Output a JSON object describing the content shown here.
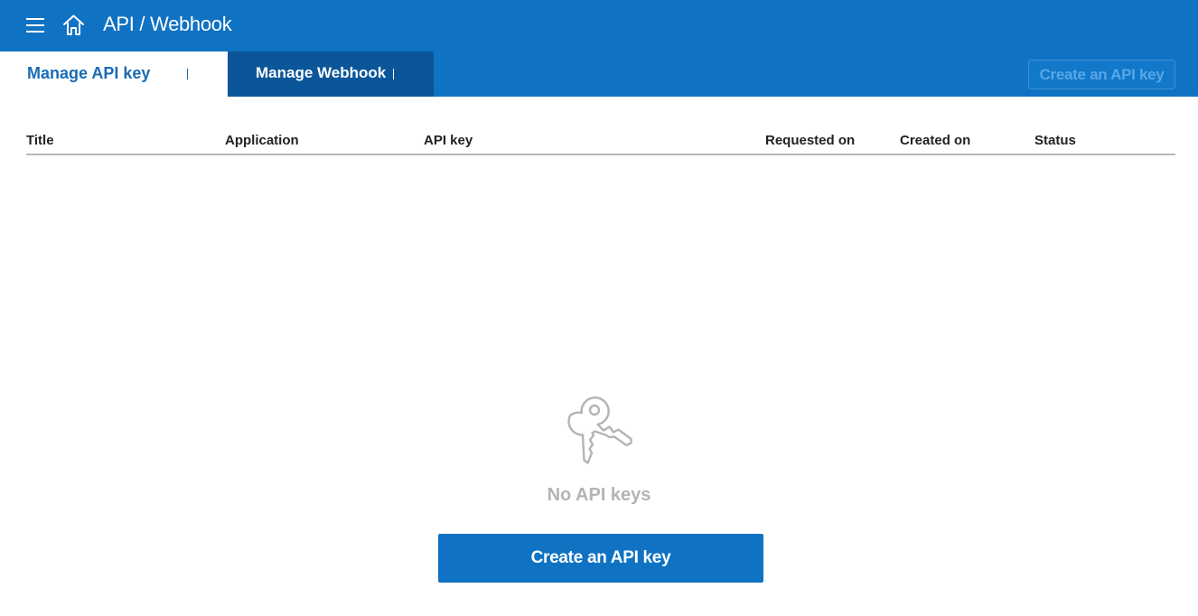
{
  "header": {
    "title": "API / Webhook",
    "create_button_label": "Create an API key",
    "background_color": "#0f72c3"
  },
  "icons": {
    "menu": "hamburger-menu-icon",
    "home": "home-icon",
    "empty_state": "key-icon"
  },
  "tabs": [
    {
      "label": "Manage API key",
      "active": true
    },
    {
      "label": "Manage Webhook",
      "active": false
    }
  ],
  "table": {
    "columns": [
      "Title",
      "Application",
      "API key",
      "Requested on",
      "Created on",
      "Status"
    ],
    "rows": []
  },
  "empty_state": {
    "message": "No API keys",
    "button_label": "Create an API key"
  }
}
